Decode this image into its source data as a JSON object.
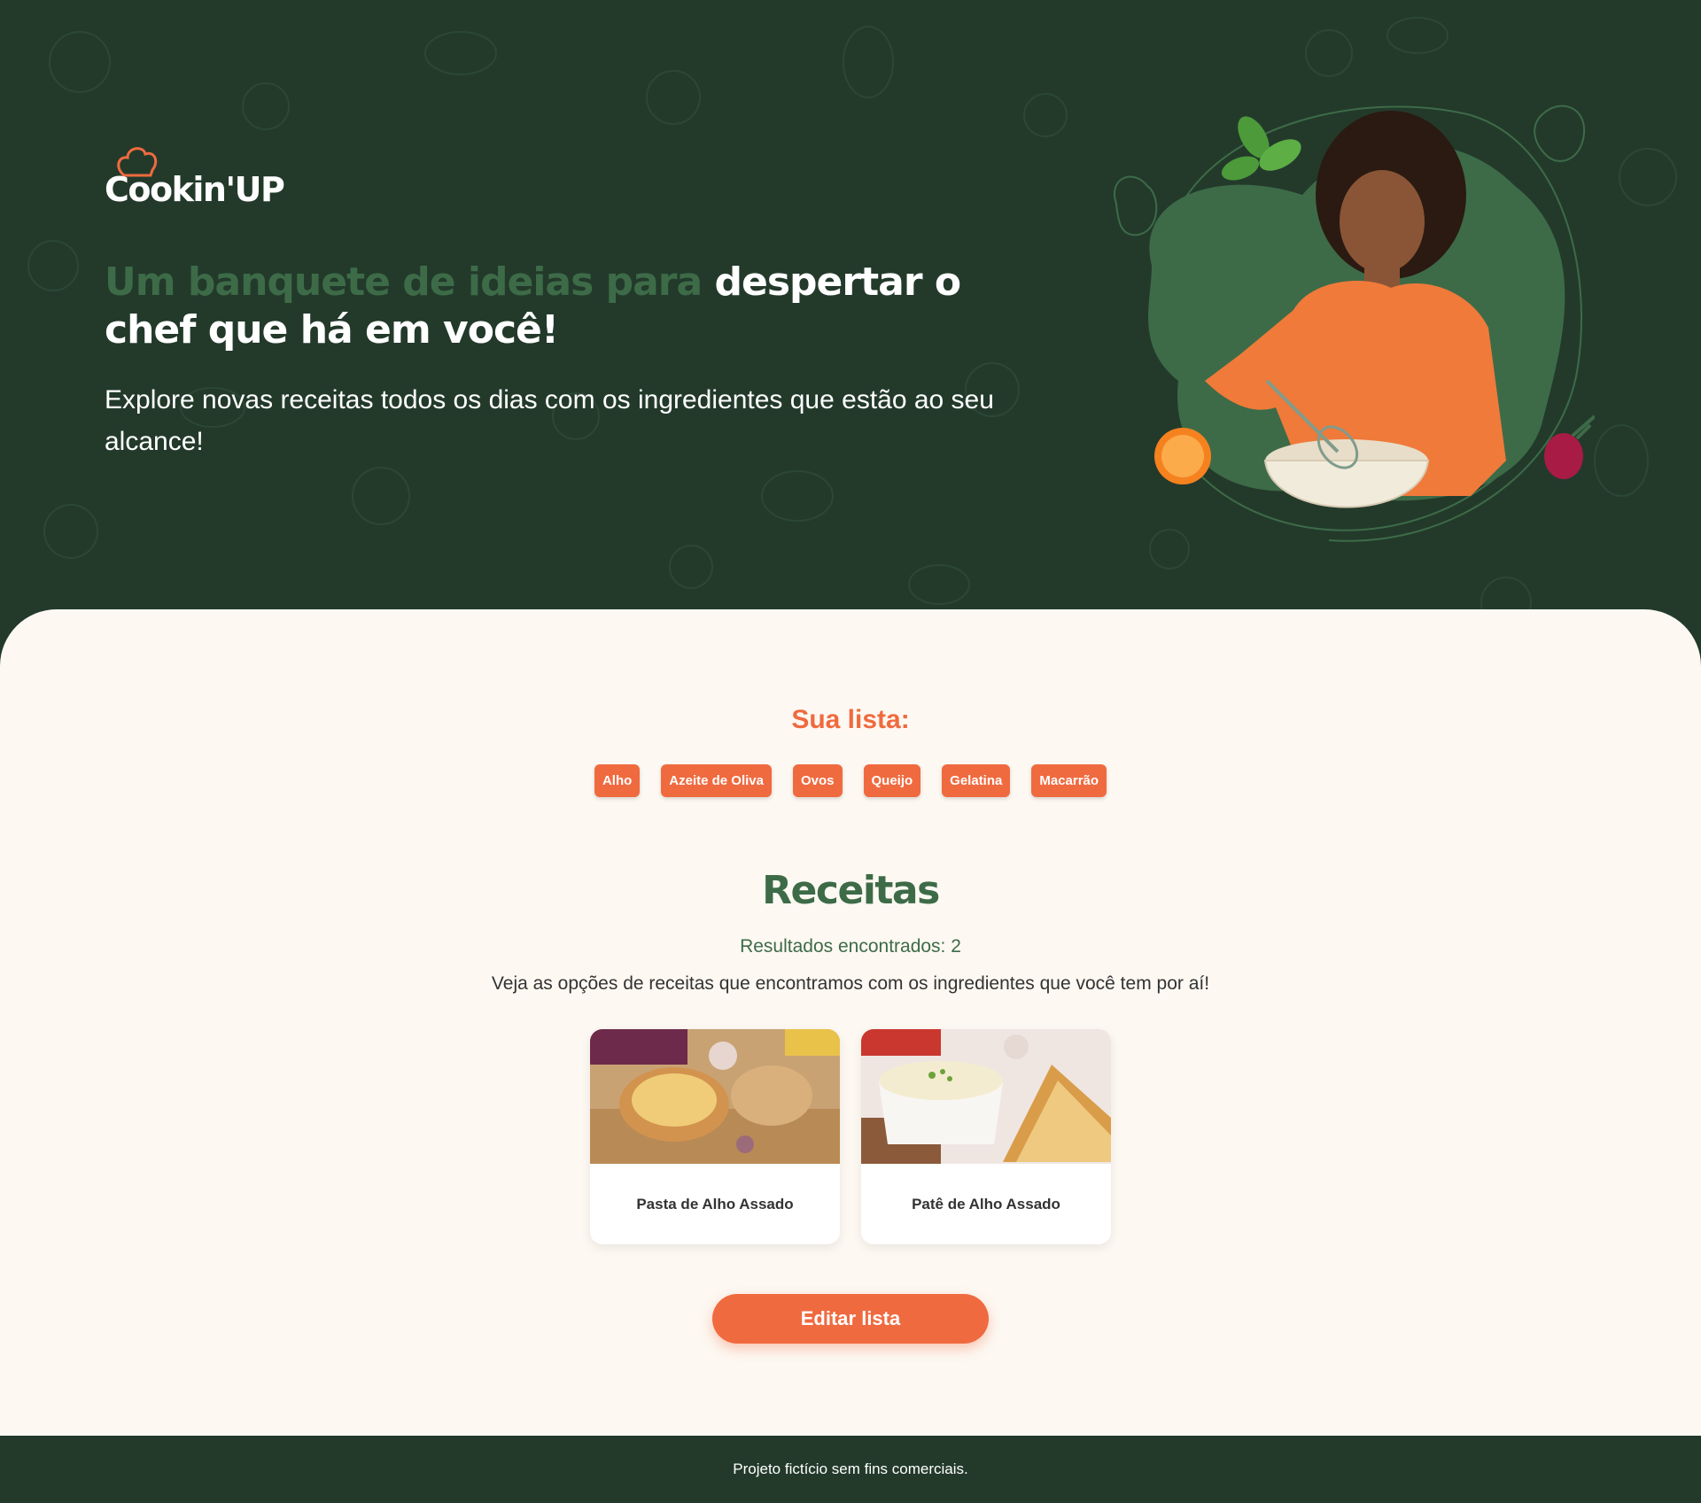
{
  "brand": {
    "logo_text": "Cookin'UP",
    "colors": {
      "dark_green": "#233a2b",
      "green": "#3d6b48",
      "orange": "#f06a3f",
      "cream": "#fdf8f2"
    }
  },
  "hero": {
    "headline_accent": "Um banquete de ideias para",
    "headline_rest": "despertar o chef que há em você!",
    "subtitle": "Explore novas receitas todos os dias com os ingredientes que estão ao seu alcance!",
    "illustration_icon": "woman-cooking-illustration"
  },
  "list": {
    "title": "Sua lista:",
    "ingredients": [
      "Alho",
      "Azeite de Oliva",
      "Ovos",
      "Queijo",
      "Gelatina",
      "Macarrão"
    ]
  },
  "recipes": {
    "title": "Receitas",
    "results": "Resultados encontrados: 2",
    "description": "Veja as opções de receitas que encontramos com os ingredientes que você tem por aí!",
    "cards": [
      {
        "title": "Pasta de Alho Assado",
        "image_icon": "garlic-paste-photo"
      },
      {
        "title": "Patê de Alho Assado",
        "image_icon": "garlic-pate-photo"
      }
    ]
  },
  "edit_button": "Editar lista",
  "footer": {
    "text": "Projeto fictício sem fins comerciais."
  }
}
